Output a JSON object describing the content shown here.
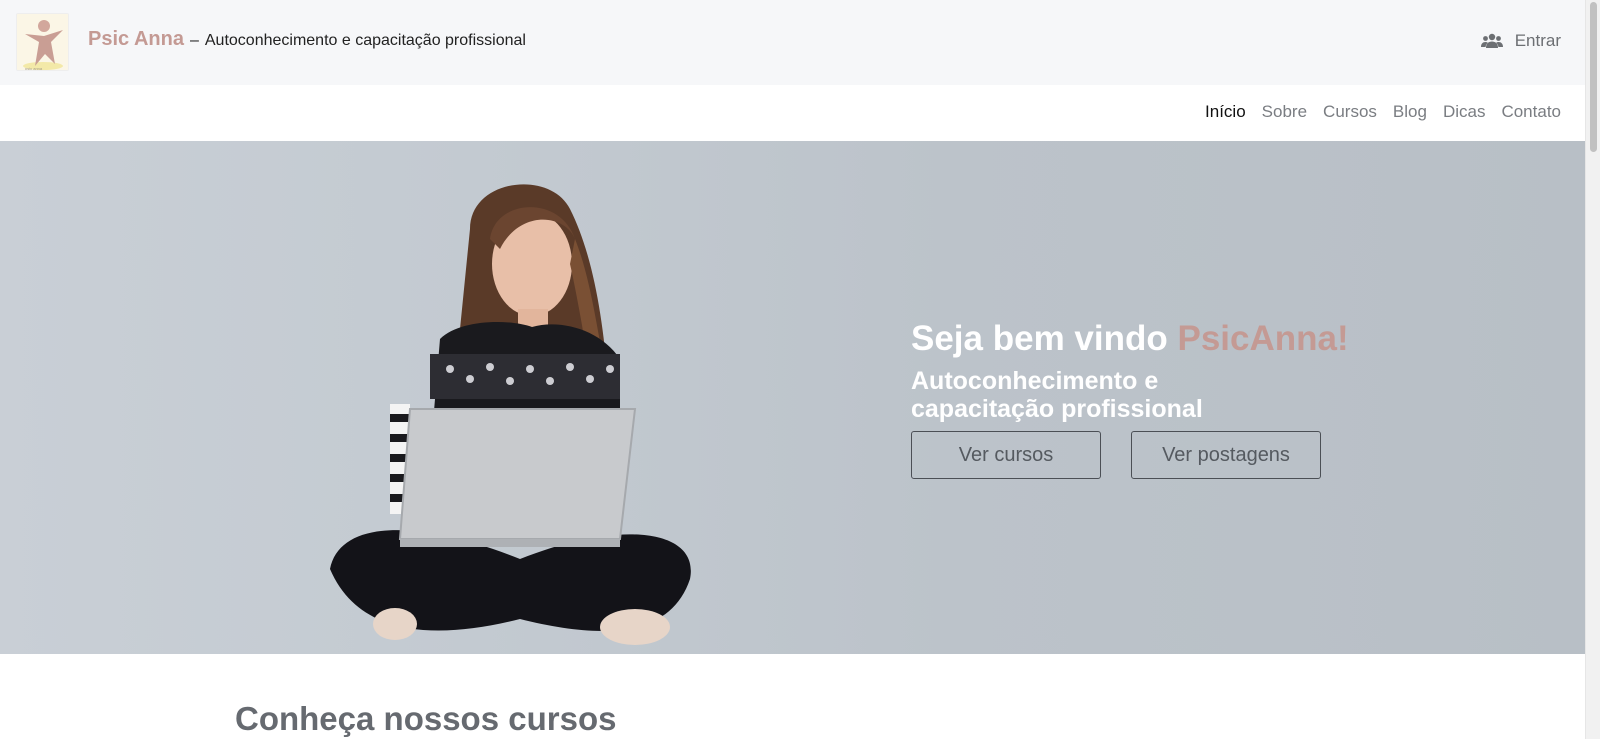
{
  "header": {
    "brand_name": "Psic Anna",
    "dash": "–",
    "tagline": "Autoconhecimento e capacitação profissional",
    "login_icon": "users-icon",
    "login_label": "Entrar",
    "logo_icon": "psicanna-logo"
  },
  "nav": {
    "items": [
      {
        "label": "Início",
        "active": true
      },
      {
        "label": "Sobre"
      },
      {
        "label": "Cursos"
      },
      {
        "label": "Blog"
      },
      {
        "label": "Dicas"
      },
      {
        "label": "Contato"
      }
    ]
  },
  "hero": {
    "title_main": "Seja bem vindo",
    "title_accent": "PsicAnna!",
    "subtitle": "Autoconhecimento e capacitação profissional",
    "buttons": [
      "Ver cursos",
      "Ver postagens"
    ]
  },
  "section": {
    "title": "Conheça nossos cursos"
  },
  "colors": {
    "accent": "#c49a94",
    "header_bg": "#f6f7f9",
    "hero_bg": "#c3cad1"
  }
}
